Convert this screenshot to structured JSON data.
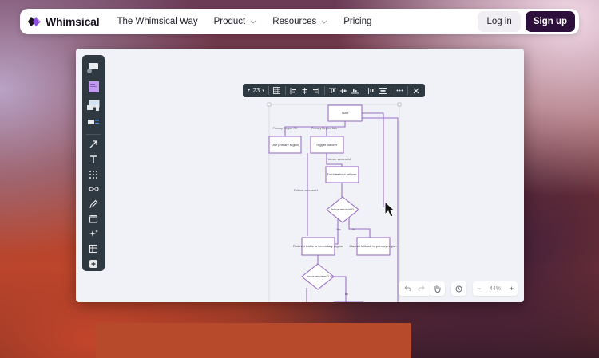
{
  "nav": {
    "logo_text": "Whimsical",
    "links": [
      {
        "label": "The Whimsical Way",
        "dropdown": false
      },
      {
        "label": "Product",
        "dropdown": true
      },
      {
        "label": "Resources",
        "dropdown": true
      },
      {
        "label": "Pricing",
        "dropdown": false
      }
    ],
    "login_label": "Log in",
    "signup_label": "Sign up"
  },
  "toolbar": {
    "filter_count": "23"
  },
  "flowchart": {
    "start": "Start",
    "use_primary": "Use primary region",
    "trigger_failover": "Trigger failover",
    "troubleshoot_failover": "Troubleshoot failover",
    "issue_resolved_1": "Issue resolved?",
    "redirect_traffic": "Redirect traffic to secondary region",
    "manual_fallback": "Manual fallback to primary region",
    "issue_resolved_2": "Issue resolved?",
    "label_primary_ok": "Primary Region OK",
    "label_primary_fails": "Primary Region fails",
    "label_failover_successful": "Failover successful",
    "label_failover_successful_2": "Failover successful",
    "label_yes": "Yes",
    "label_no": "No",
    "label_no_2": "No"
  },
  "zoom": {
    "level": "44%",
    "minus": "−",
    "plus": "+"
  },
  "colors": {
    "brand_dark": "#2c0f3a",
    "flow_purple": "#9b6fc6",
    "toolbar_dark": "#2f3942"
  }
}
